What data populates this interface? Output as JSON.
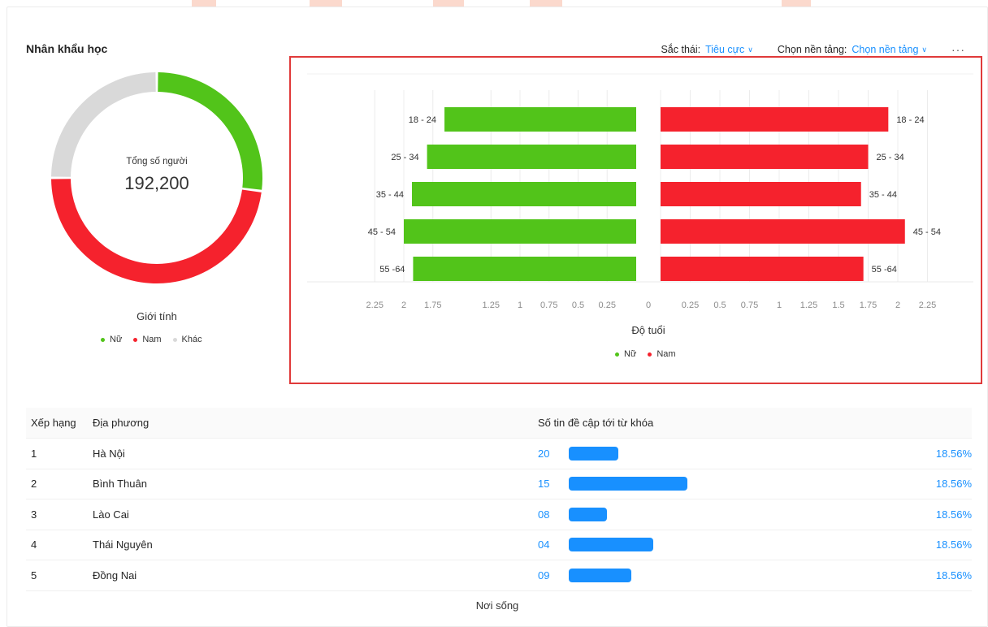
{
  "colors": {
    "female": "#52c41a",
    "male": "#f5222d",
    "other": "#d9d9d9",
    "accent": "#1890ff",
    "highlight": "#e03a3a"
  },
  "header": {
    "title": "Nhân khẩu học",
    "sentiment_label": "Sắc thái:",
    "sentiment_value": "Tiêu cực",
    "platform_label": "Chọn nền tảng:",
    "platform_value": "Chọn nền tảng",
    "more": "···"
  },
  "donut": {
    "center_caption": "Tổng số người",
    "total": "192,200",
    "legend_title": "Giới tính",
    "legend": [
      "Nữ",
      "Nam",
      "Khác"
    ]
  },
  "chart_data": [
    {
      "type": "pie",
      "categories": [
        "Nữ",
        "Nam",
        "Khác"
      ],
      "values": [
        27,
        48,
        25
      ],
      "colors": [
        "#52c41a",
        "#f5222d",
        "#d9d9d9"
      ]
    },
    {
      "type": "bar",
      "orientation": "horizontal-butterfly",
      "categories": [
        "18 - 24",
        "25 - 34",
        "35 - 44",
        "45 - 54",
        "55 -64"
      ],
      "series": [
        {
          "name": "Nữ",
          "values": [
            1.65,
            1.8,
            1.93,
            2.0,
            1.92
          ]
        },
        {
          "name": "Nam",
          "values": [
            1.92,
            1.75,
            1.69,
            2.06,
            1.71
          ]
        }
      ],
      "x_ticks_left": [
        "2.25",
        "2",
        "1.75",
        "1.25",
        "1",
        "0.75",
        "0.5",
        "0.25"
      ],
      "x_ticks_right": [
        "0",
        "0.25",
        "0.5",
        "0.75",
        "1",
        "1.25",
        "1.5",
        "1.75",
        "2",
        "2.25"
      ],
      "xlabel": "Độ tuổi",
      "xlim": [
        0,
        2.25
      ],
      "grid": "vertical",
      "legend_position": "bottom-center"
    }
  ],
  "table": {
    "headers": {
      "rank": "Xếp hạng",
      "place": "Địa phương",
      "count": "Số tin đề cập tới từ khóa"
    },
    "rows": [
      {
        "rank": "1",
        "place": "Hà Nội",
        "count": "20",
        "bar": 0.42,
        "pct": "18.56%"
      },
      {
        "rank": "2",
        "place": "Bình Thuân",
        "count": "15",
        "bar": 1.0,
        "pct": "18.56%"
      },
      {
        "rank": "3",
        "place": "Lào Cai",
        "count": "08",
        "bar": 0.32,
        "pct": "18.56%"
      },
      {
        "rank": "4",
        "place": "Thái Nguyên",
        "count": "04",
        "bar": 0.71,
        "pct": "18.56%"
      },
      {
        "rank": "5",
        "place": "Đồng Nai",
        "count": "09",
        "bar": 0.53,
        "pct": "18.56%"
      }
    ],
    "caption": "Nơi sống"
  }
}
